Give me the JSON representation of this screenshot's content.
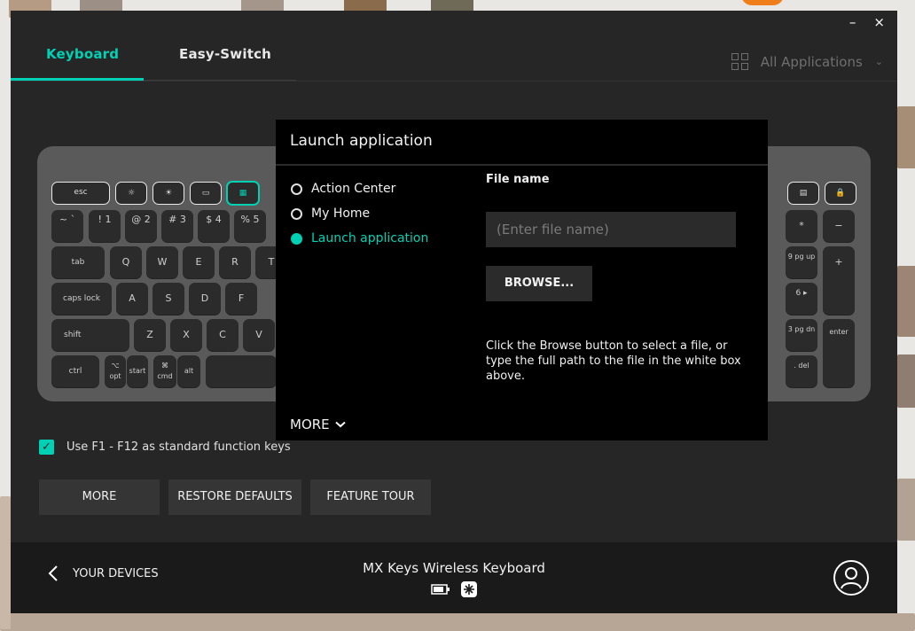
{
  "window": {
    "minimize_glyph": "–",
    "close_glyph": "×"
  },
  "tabs": [
    {
      "label": "Keyboard",
      "active": true
    },
    {
      "label": "Easy-Switch",
      "active": false
    }
  ],
  "app_selector": {
    "label": "All Applications",
    "icon": "grid-icon"
  },
  "keyboard": {
    "fn_keys": [
      "esc",
      "☼",
      "☀",
      "▭",
      "▦",
      "",
      "",
      "",
      "",
      "",
      "▤",
      "🔒"
    ],
    "row1": [
      "~ `",
      "! 1",
      "@ 2",
      "# 3",
      "$ 4",
      "% 5"
    ],
    "row2": [
      "tab",
      "Q",
      "W",
      "E",
      "R",
      "T"
    ],
    "row3": [
      "caps lock",
      "A",
      "S",
      "D",
      "F"
    ],
    "row4": [
      "shift",
      "Z",
      "X",
      "C",
      "V"
    ],
    "row5": [
      "ctrl",
      "⌥ opt",
      "start",
      "⌘ cmd",
      "alt"
    ],
    "numpad": [
      "*",
      "−",
      "9 pg up",
      "+",
      "6 ▸",
      "3 pg dn",
      "enter",
      ". del",
      "="
    ]
  },
  "popup": {
    "title": "Launch application",
    "options": [
      {
        "label": "Action Center",
        "selected": false
      },
      {
        "label": "My Home",
        "selected": false
      },
      {
        "label": "Launch application",
        "selected": true
      }
    ],
    "file_label": "File name",
    "file_placeholder": "(Enter file name)",
    "file_value": "",
    "browse_label": "BROWSE...",
    "help_text": "Click the Browse button to select a file, or type the full path to the file in the white box above.",
    "more_label": "MORE"
  },
  "fn_checkbox": {
    "label": "Use F1 - F12 as standard function keys",
    "checked": true
  },
  "buttons": {
    "more": "MORE",
    "restore": "RESTORE DEFAULTS",
    "tour": "FEATURE TOUR"
  },
  "footer": {
    "back_label": "YOUR DEVICES",
    "device_name": "MX Keys Wireless Keyboard",
    "battery_icon": "battery-icon",
    "receiver_icon": "unifying-receiver-icon"
  },
  "colors": {
    "accent": "#00d1b5",
    "window_bg": "#262626",
    "popup_bg": "#000000",
    "footer_bg": "#1a1a1a"
  }
}
